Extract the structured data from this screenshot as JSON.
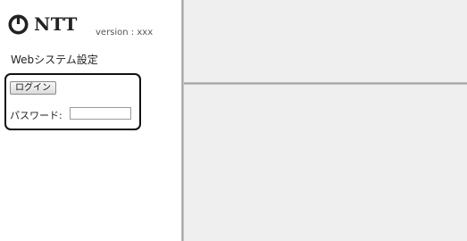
{
  "header": {
    "logo_text": "NTT",
    "version": "version : xxx"
  },
  "sidebar": {
    "title": "Webシステム設定",
    "login_button": "ログイン",
    "password_label": "パスワード:",
    "password_value": ""
  },
  "colors": {
    "frame_background": "#efefef",
    "sidebar_background": "#ffffff",
    "highlight_border": "#111111"
  }
}
